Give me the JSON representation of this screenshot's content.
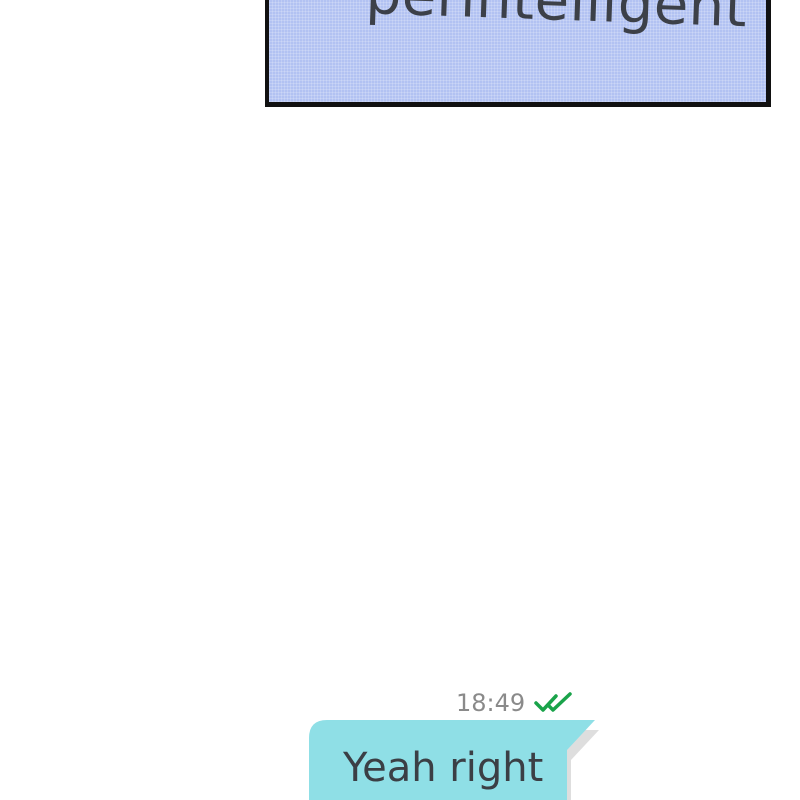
{
  "caption": {
    "text": "perintelligent"
  },
  "message": {
    "time": "18:49",
    "status_icon": "double-check-icon",
    "text": "Yeah right"
  },
  "colors": {
    "caption_bg": "#b2c2f2",
    "caption_border": "#111111",
    "bubble_bg": "#8fdfe6",
    "check_green": "#1aa34a",
    "time_gray": "#8a8a8a"
  }
}
